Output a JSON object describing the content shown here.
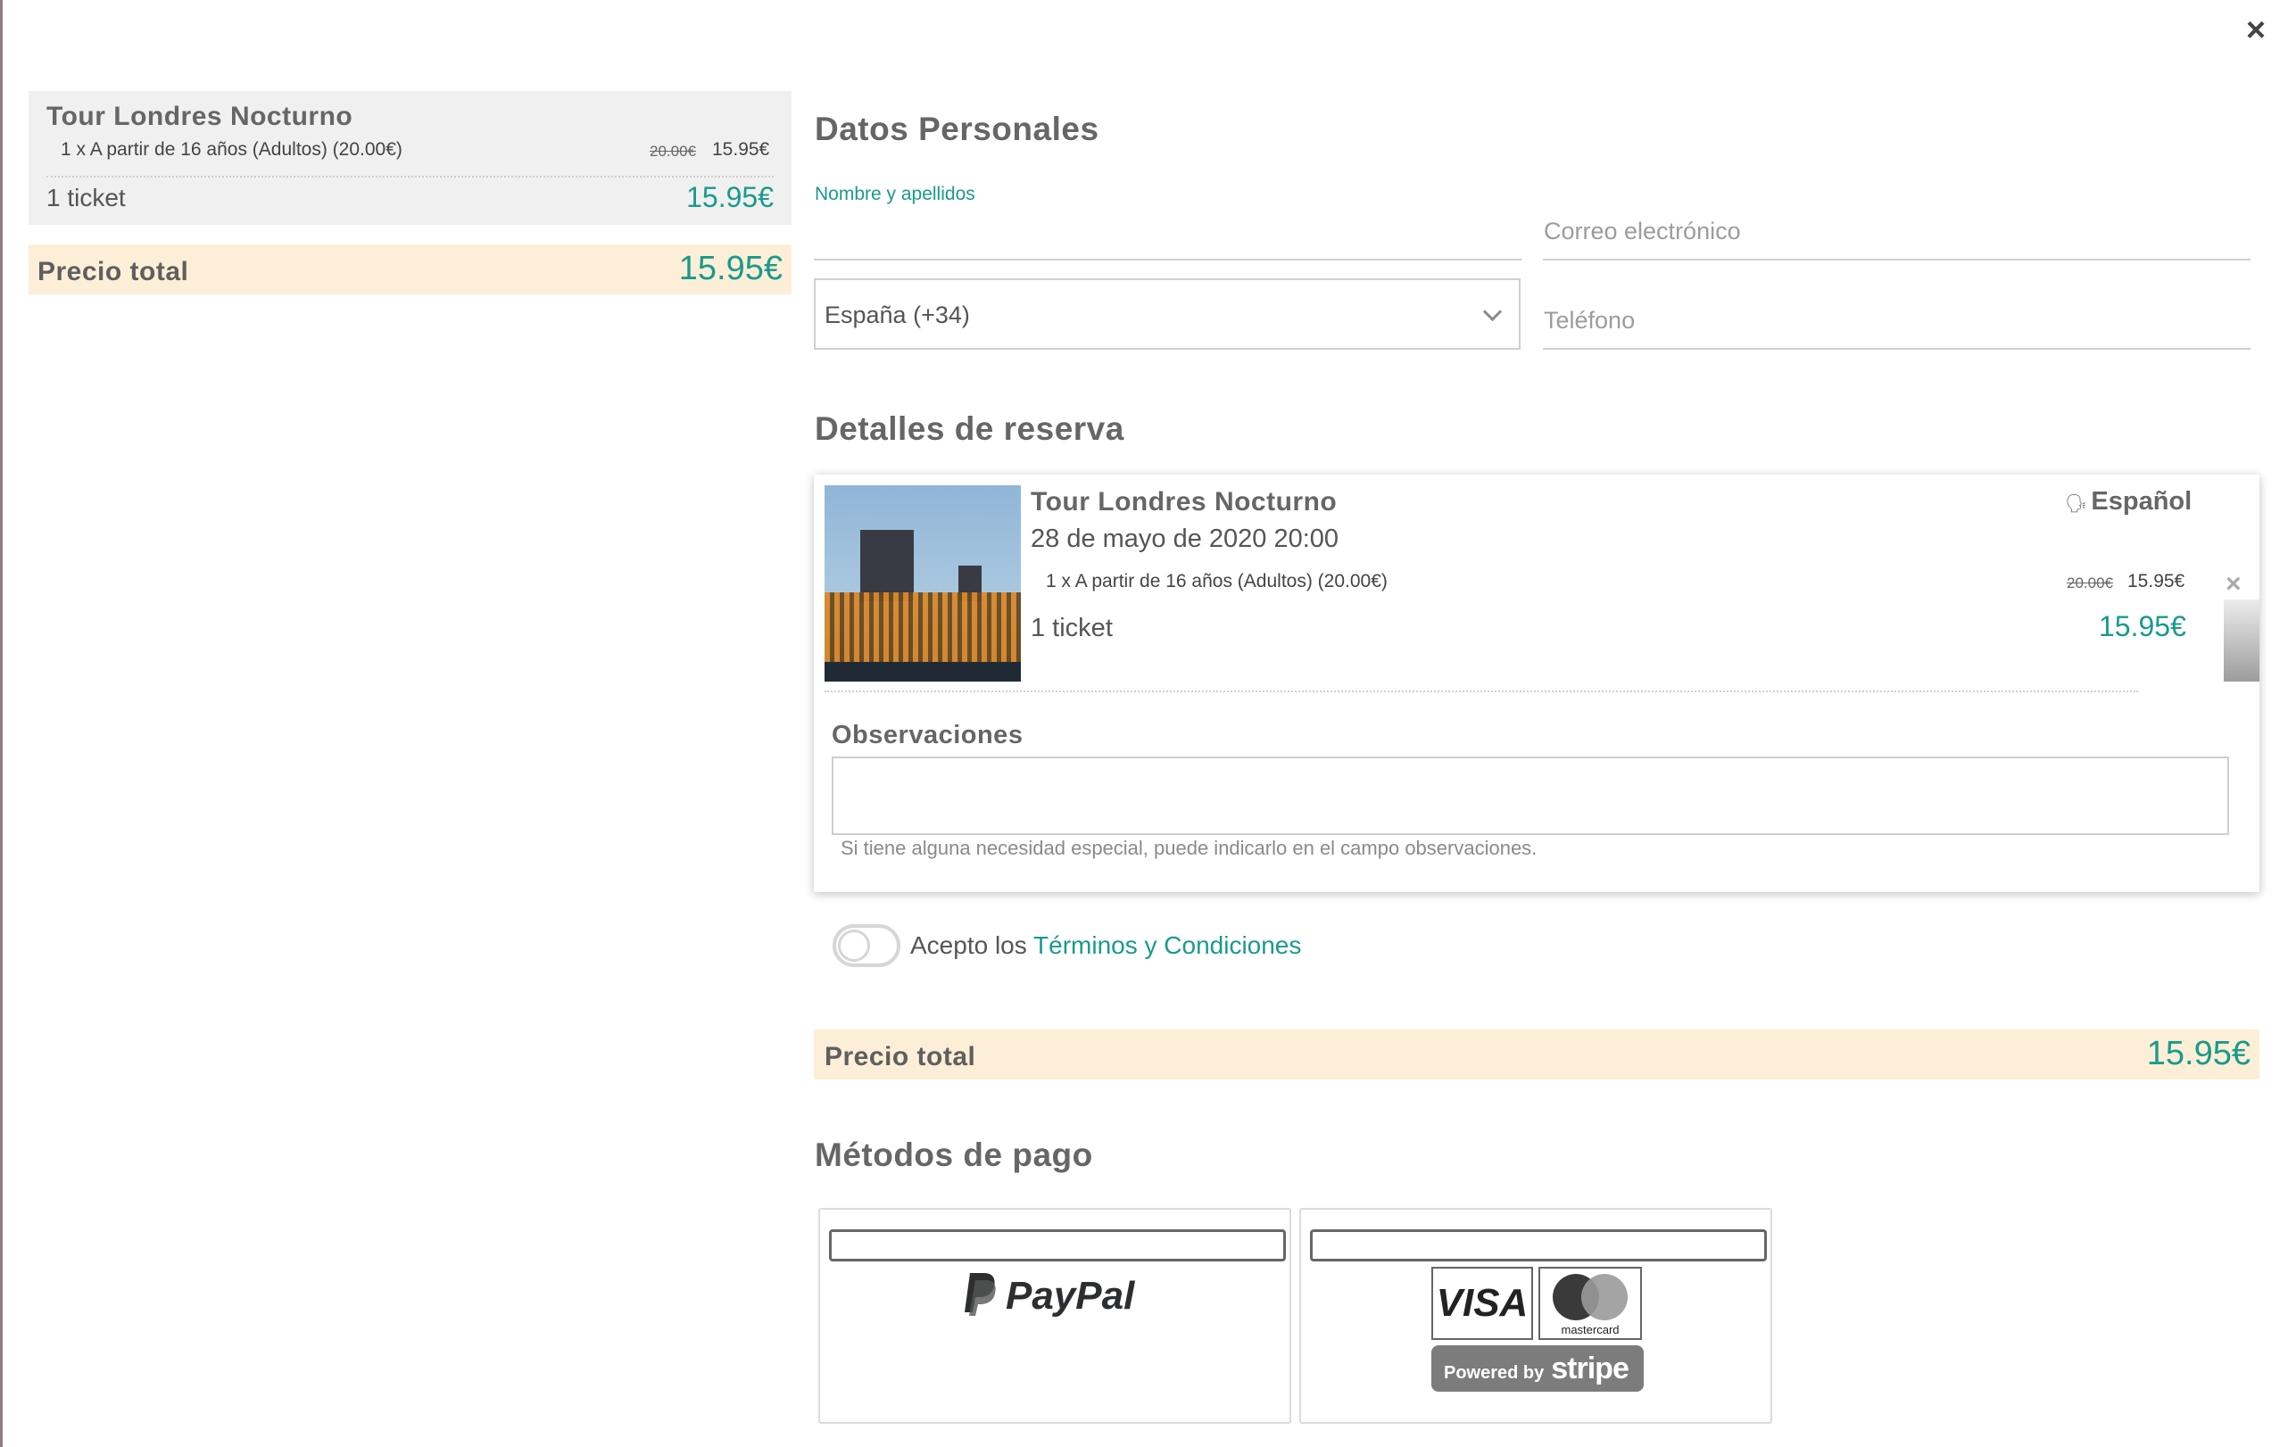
{
  "modal": {
    "close_label": "×"
  },
  "summary": {
    "title": "Tour Londres Nocturno",
    "line": "1 x A partir de 16 años (Adultos) (20.00€)",
    "old_price": "20.00€",
    "new_price": "15.95€",
    "tickets": "1 ticket",
    "tickets_price": "15.95€",
    "total_label": "Precio total",
    "total_price": "15.95€"
  },
  "personal": {
    "title": "Datos Personales",
    "name_label": "Nombre y apellidos",
    "email_placeholder": "Correo electrónico",
    "country_value": "España (+34)",
    "phone_placeholder": "Teléfono"
  },
  "booking": {
    "title": "Detalles de reserva",
    "tour_title": "Tour Londres Nocturno",
    "date": "28 de mayo de 2020 20:00",
    "line": "1 x A partir de 16 años (Adultos) (20.00€)",
    "old_price": "20.00€",
    "new_price": "15.95€",
    "tickets": "1 ticket",
    "tickets_price": "15.95€",
    "language": "Español",
    "remove_label": "×",
    "obs_label": "Observaciones",
    "obs_help": "Si tiene alguna necesidad especial, puede indicarlo en el campo observaciones."
  },
  "terms": {
    "prefix": "Acepto los",
    "link": "Términos y Condiciones"
  },
  "total": {
    "label": "Precio total",
    "price": "15.95€"
  },
  "payment": {
    "title": "Métodos de pago",
    "paypal_label": "PayPal",
    "visa_label": "VISA",
    "mastercard_label": "mastercard",
    "stripe_prefix": "Powered by",
    "stripe_name": "stripe"
  },
  "colors": {
    "accent": "#1a9a8c",
    "total_bg": "#fdefd7",
    "summary_bg": "#f0f0f0"
  }
}
